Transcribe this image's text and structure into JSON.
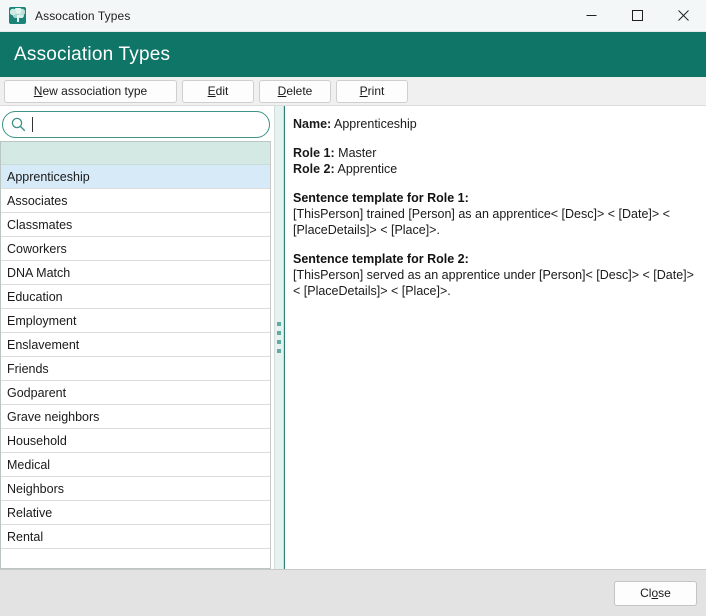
{
  "window": {
    "titlebar_text": "Assocation Types",
    "app_icon": "family-tree-icon",
    "controls": {
      "minimize": "minimize-icon",
      "maximize": "maximize-icon",
      "close": "close-icon"
    }
  },
  "header": {
    "title": "Association Types",
    "bg_color": "#0f7567"
  },
  "toolbar": {
    "buttons": [
      {
        "mnemonic": "N",
        "rest": "ew association type",
        "name": "new-association-type-button"
      },
      {
        "mnemonic": "E",
        "rest": "dit",
        "name": "edit-button"
      },
      {
        "mnemonic": "D",
        "rest": "elete",
        "name": "delete-button"
      },
      {
        "mnemonic": "P",
        "rest": "rint",
        "name": "print-button"
      }
    ]
  },
  "search": {
    "value": "",
    "placeholder": "",
    "icon": "search-icon",
    "border_color": "#3e9287"
  },
  "list": {
    "selected_index": 0,
    "items": [
      "Apprenticeship",
      "Associates",
      "Classmates",
      "Coworkers",
      "DNA Match",
      "Education",
      "Employment",
      "Enslavement",
      "Friends",
      "Godparent",
      "Grave neighbors",
      "Household",
      "Medical",
      "Neighbors",
      "Relative",
      "Rental"
    ]
  },
  "splitter": {
    "grip_dots": 4,
    "dot_color": "#63aaa0"
  },
  "detail": {
    "name_label": "Name:",
    "name_value": "Apprenticeship",
    "role1_label": "Role 1:",
    "role1_value": "Master",
    "role2_label": "Role 2:",
    "role2_value": "Apprentice",
    "template1_heading": "Sentence template for Role 1:",
    "template1_text": "[ThisPerson] trained [Person] as an apprentice< [Desc]> < [Date]> < [PlaceDetails]> < [Place]>.",
    "template2_heading": "Sentence template for Role 2:",
    "template2_text": "[ThisPerson] served as an apprentice under [Person]< [Desc]> < [Date]> < [PlaceDetails]> < [Place]>."
  },
  "footer": {
    "close_mnemonic_before": "Cl",
    "close_mnemonic": "o",
    "close_mnemonic_after": "se"
  }
}
